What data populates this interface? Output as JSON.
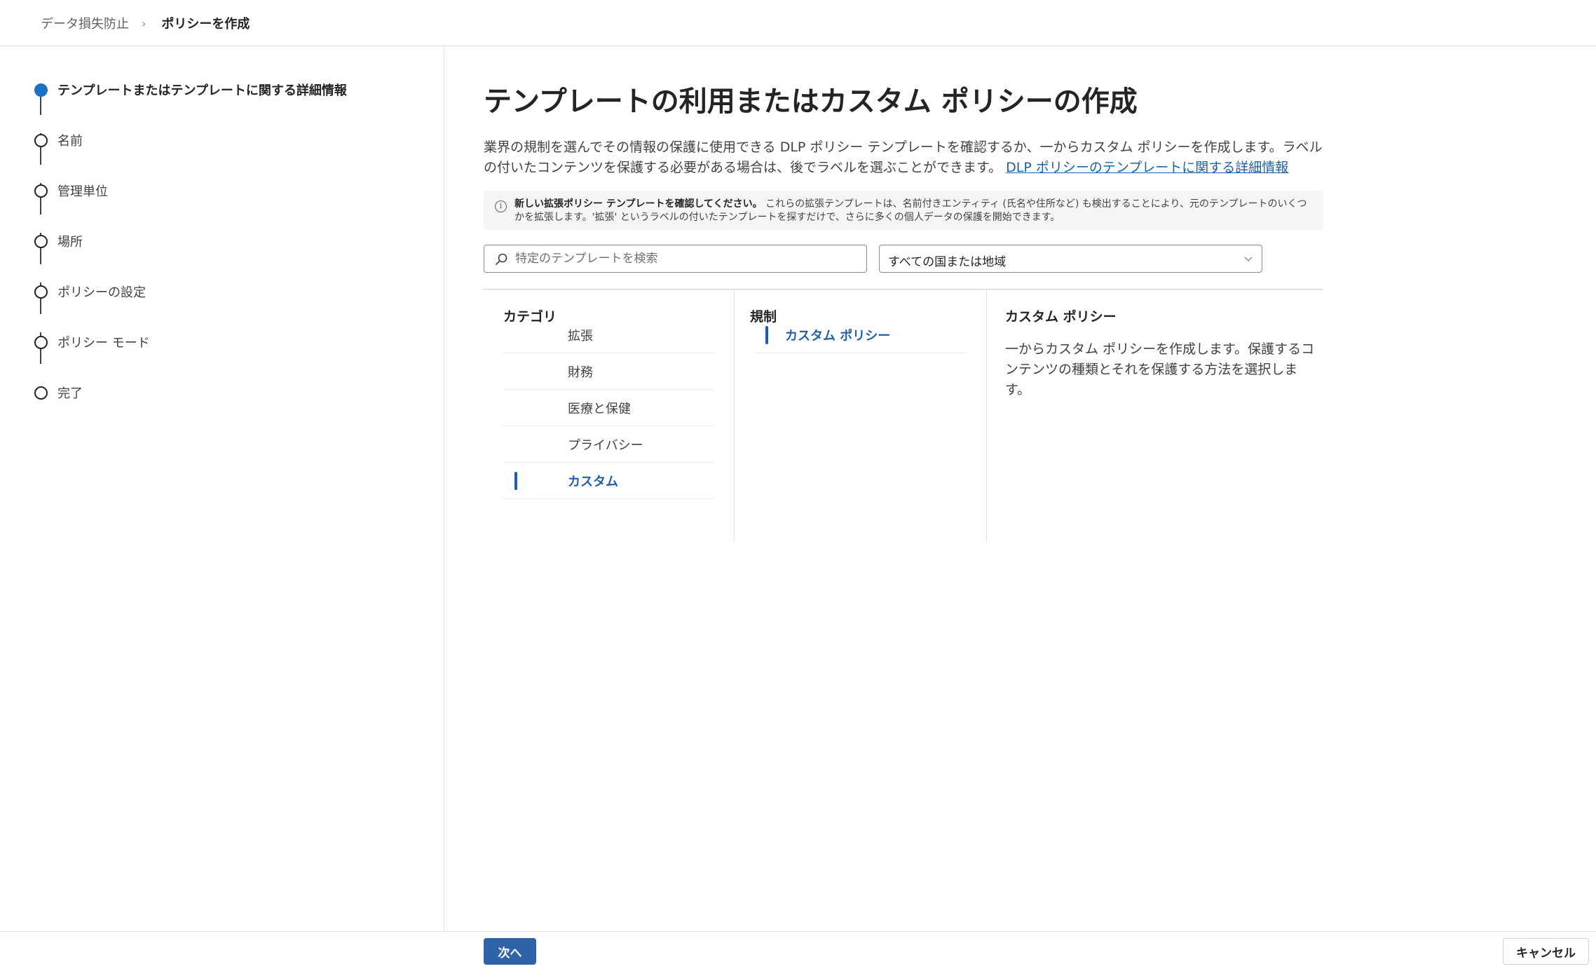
{
  "breadcrumb": {
    "parent": "データ損失防止",
    "separator": "›",
    "current": "ポリシーを作成"
  },
  "steps": [
    {
      "label": "テンプレートまたはテンプレートに関する詳細情報",
      "active": true
    },
    {
      "label": "名前",
      "active": false
    },
    {
      "label": "管理単位",
      "active": false
    },
    {
      "label": "場所",
      "active": false
    },
    {
      "label": "ポリシーの設定",
      "active": false
    },
    {
      "label": "ポリシー モード",
      "active": false
    },
    {
      "label": "完了",
      "active": false
    }
  ],
  "main": {
    "title": "テンプレートの利用またはカスタム ポリシーの作成",
    "description": "業界の規制を選んでその情報の保護に使用できる DLP ポリシー テンプレートを確認するか、一からカスタム ポリシーを作成します。ラベルの付いたコンテンツを保護する必要がある場合は、後でラベルを選ぶことができます。",
    "learn_more_link": "DLP ポリシーのテンプレートに関する詳細情報",
    "info_bold": "新しい拡張ポリシー テンプレートを確認してください。",
    "info_text": "これらの拡張テンプレートは、名前付きエンティティ (氏名や住所など) も検出することにより、元のテンプレートのいくつかを拡張します。'拡張' というラベルの付いたテンプレートを探すだけで、さらに多くの個人データの保護を開始できます。",
    "search_placeholder": "特定のテンプレートを検索",
    "region_select": "すべての国または地域"
  },
  "categories": {
    "header": "カテゴリ",
    "items": [
      "拡張",
      "財務",
      "医療と保健",
      "プライバシー",
      "カスタム"
    ],
    "selected": "カスタム"
  },
  "regulations": {
    "header": "規制",
    "items": [
      "カスタム ポリシー"
    ],
    "selected": "カスタム ポリシー"
  },
  "details": {
    "title": "カスタム ポリシー",
    "text": "一からカスタム ポリシーを作成します。保護するコンテンツの種類とそれを保護する方法を選択します。"
  },
  "footer": {
    "next_label": "次へ",
    "cancel_label": "キャンセル"
  },
  "colors": {
    "accent": "#1f6fc5",
    "link": "#1f5fa8",
    "primary_button": "#2f63a8"
  }
}
